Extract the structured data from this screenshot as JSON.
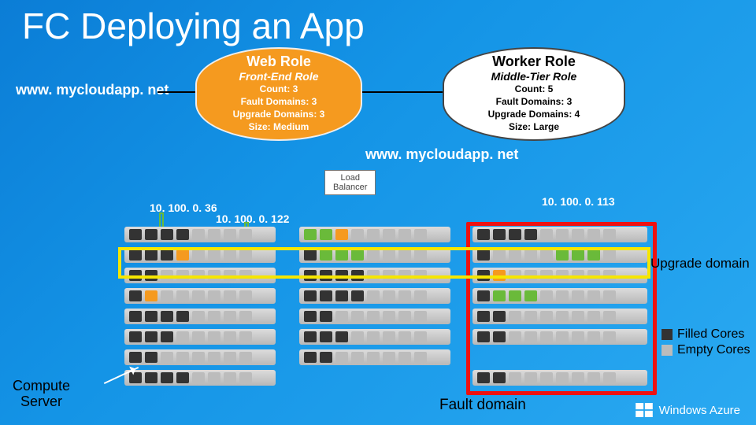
{
  "title": "FC Deploying an App",
  "domain_label_left": "www. mycloudapp. net",
  "domain_label_mid": "www. mycloudapp. net",
  "roles": {
    "web": {
      "head": "Web Role",
      "sub": "Front-End Role",
      "count": "Count: 3",
      "fd": "Fault Domains: 3",
      "ud": "Upgrade Domains: 3",
      "size": "Size: Medium"
    },
    "worker": {
      "head": "Worker Role",
      "sub": "Middle-Tier Role",
      "count": "Count: 5",
      "fd": "Fault Domains: 3",
      "ud": "Upgrade Domains: 4",
      "size": "Size: Large"
    }
  },
  "load_balancer": {
    "line1": "Load",
    "line2": "Balancer"
  },
  "ips": {
    "a": "10. 100. 0. 36",
    "b": "10. 100. 0. 122",
    "c": "10. 100. 0. 113"
  },
  "labels": {
    "upgrade_domain": "Upgrade domain",
    "fault_domain": "Fault domain",
    "compute_server_l1": "Compute",
    "compute_server_l2": "Server",
    "legend_filled": "Filled Cores",
    "legend_empty": "Empty Cores",
    "azure": "Windows Azure"
  },
  "racks": [
    {
      "servers": [
        [
          "f",
          "f",
          "f",
          "f",
          "e",
          "e",
          "e",
          "e"
        ],
        [
          "f",
          "f",
          "f",
          "o",
          "e",
          "e",
          "e",
          "e"
        ],
        [
          "f",
          "f",
          "e",
          "e",
          "e",
          "e",
          "e",
          "e"
        ],
        [
          "f",
          "o",
          "e",
          "e",
          "e",
          "e",
          "e",
          "e"
        ],
        [
          "f",
          "f",
          "f",
          "f",
          "e",
          "e",
          "e",
          "e"
        ],
        [
          "f",
          "f",
          "f",
          "e",
          "e",
          "e",
          "e",
          "e"
        ],
        [
          "f",
          "f",
          "e",
          "e",
          "e",
          "e",
          "e",
          "e"
        ],
        [
          "f",
          "f",
          "f",
          "f",
          "e",
          "e",
          "e",
          "e"
        ]
      ]
    },
    {
      "servers": [
        [
          "g",
          "g",
          "o",
          "e",
          "e",
          "e",
          "e",
          "e"
        ],
        [
          "f",
          "g",
          "g",
          "g",
          "e",
          "e",
          "e",
          "e"
        ],
        [
          "f",
          "f",
          "f",
          "f",
          "e",
          "e",
          "e",
          "e"
        ],
        [
          "f",
          "f",
          "f",
          "f",
          "e",
          "e",
          "e",
          "e"
        ],
        [
          "f",
          "f",
          "e",
          "e",
          "e",
          "e",
          "e",
          "e"
        ],
        [
          "f",
          "f",
          "f",
          "e",
          "e",
          "e",
          "e",
          "e"
        ],
        [
          "f",
          "f",
          "e",
          "e",
          "e",
          "e",
          "e",
          "e"
        ],
        [
          "",
          "",
          "",
          "",
          "",
          "",
          "",
          ""
        ]
      ]
    },
    {
      "servers": [
        [
          "f",
          "f",
          "f",
          "f",
          "e",
          "e",
          "e",
          "e",
          "e"
        ],
        [
          "f",
          "e",
          "e",
          "e",
          "e",
          "g",
          "g",
          "g",
          "e"
        ],
        [
          "f",
          "o",
          "e",
          "e",
          "e",
          "e",
          "e",
          "e",
          "e"
        ],
        [
          "f",
          "g",
          "g",
          "g",
          "e",
          "e",
          "e",
          "e",
          "e"
        ],
        [
          "f",
          "f",
          "e",
          "e",
          "e",
          "e",
          "e",
          "e",
          "e"
        ],
        [
          "f",
          "f",
          "e",
          "e",
          "e",
          "e",
          "e",
          "e",
          "e"
        ],
        [
          "",
          "",
          "",
          "",
          "",
          "",
          "",
          "",
          ""
        ],
        [
          "f",
          "f",
          "e",
          "e",
          "e",
          "e",
          "e",
          "e",
          "e"
        ]
      ]
    }
  ]
}
